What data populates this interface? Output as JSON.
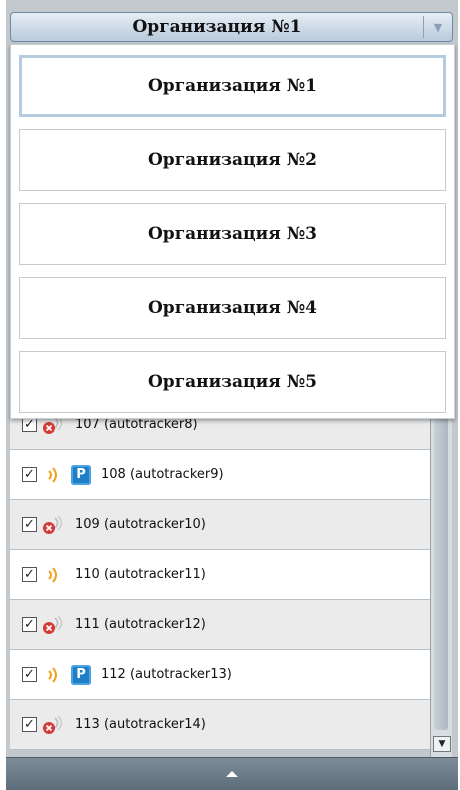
{
  "org_select": {
    "value": "Организация №1"
  },
  "dropdown": {
    "options": [
      "Организация №1",
      "Организация №2",
      "Организация №3",
      "Организация №4",
      "Организация №5"
    ],
    "selected_index": 0
  },
  "vehicles": [
    {
      "label": "107 (autotracker8)",
      "checked": true,
      "status": "offline-icon",
      "parking": false
    },
    {
      "label": "108 (autotracker9)",
      "checked": true,
      "status": "signal-icon",
      "parking": true
    },
    {
      "label": "109 (autotracker10)",
      "checked": true,
      "status": "offline-icon",
      "parking": false
    },
    {
      "label": "110 (autotracker11)",
      "checked": true,
      "status": "signal-icon",
      "parking": false
    },
    {
      "label": "111 (autotracker12)",
      "checked": true,
      "status": "offline-icon",
      "parking": false
    },
    {
      "label": "112 (autotracker13)",
      "checked": true,
      "status": "signal-icon",
      "parking": true
    },
    {
      "label": "113 (autotracker14)",
      "checked": true,
      "status": "offline-icon",
      "parking": false
    }
  ],
  "parking_badge": "P",
  "colors": {
    "accent": "#b4cbe0",
    "offline": "#d63a36",
    "signal": "#f0a21a",
    "parking": "#1e7fc6"
  }
}
